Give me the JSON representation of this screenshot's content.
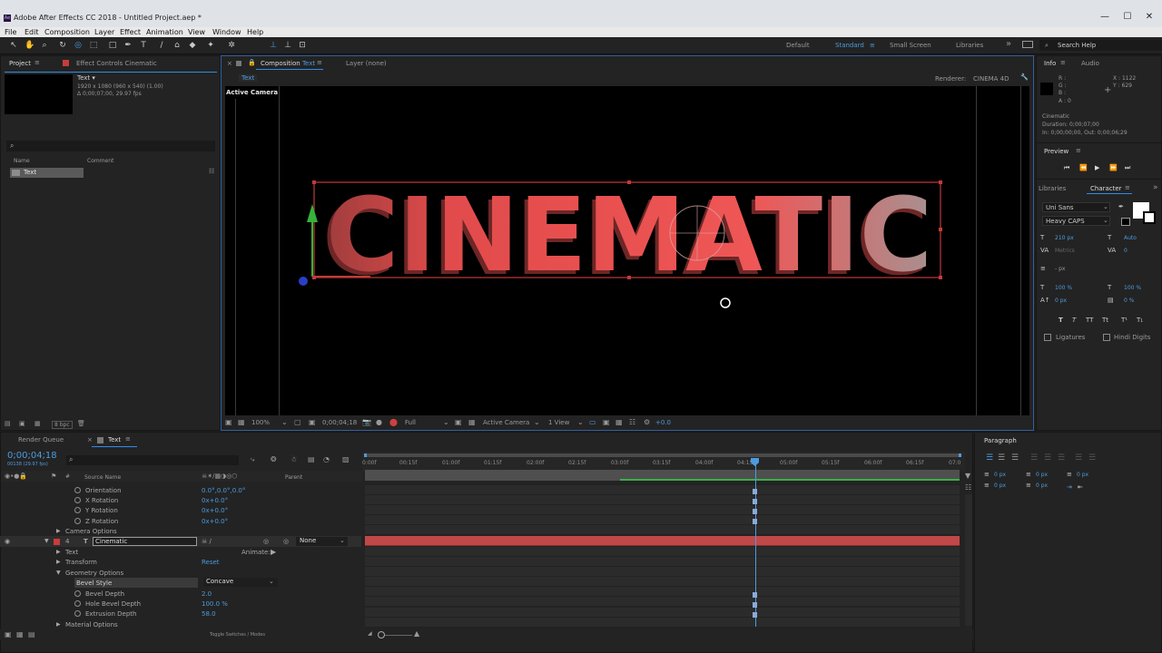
{
  "window": {
    "title": "Adobe After Effects CC 2018 - Untitled Project.aep *",
    "app_icon": "Ae",
    "controls": [
      "—",
      "☐",
      "✕"
    ]
  },
  "menu": [
    "File",
    "Edit",
    "Composition",
    "Layer",
    "Effect",
    "Animation",
    "View",
    "Window",
    "Help"
  ],
  "workspaces": {
    "items": [
      "Default",
      "Standard",
      "Small Screen",
      "Libraries"
    ],
    "active": "Standard",
    "more": "»"
  },
  "search_help": "Search Help",
  "project": {
    "tab": "Project",
    "effect_tab": "Effect Controls Cinematic",
    "item_name": "Text ▾",
    "item_res": "1920 x 1080 (960 x 540) (1.00)",
    "item_dur": "Δ 0;00;07;00, 29.97 fps",
    "col_name": "Name",
    "col_comment": "Comment",
    "row": "Text",
    "bpc": "8 bpc"
  },
  "composition": {
    "tab_prefix": "Composition",
    "tab_name": "Text",
    "layer_tab": "Layer (none)",
    "breadcrumb": "Text",
    "renderer_label": "Renderer:",
    "renderer": "CINEMA 4D",
    "active_camera": "Active Camera",
    "headline": "CINEMATIC"
  },
  "viewer_footer": {
    "zoom": "100%",
    "time": "0;00;04;18",
    "resolution": "Full",
    "camera": "Active Camera",
    "views": "1 View",
    "exposure": "+0.0"
  },
  "info": {
    "tab": "Info",
    "audio_tab": "Audio",
    "rgba": [
      "R :",
      "G :",
      "B :",
      "A : 0"
    ],
    "x": "X : 1122",
    "y": "Y : 629",
    "layer": "Cinematic",
    "duration": "Duration: 0;00;07;00",
    "inout": "In: 0;00;00;00, Out: 0;00;06;29"
  },
  "preview": {
    "tab": "Preview"
  },
  "character": {
    "libraries_tab": "Libraries",
    "tab": "Character",
    "font": "Uni Sans",
    "style": "Heavy CAPS",
    "size": "210 px",
    "leading": "Auto",
    "kerning": "Metrics",
    "tracking": "0",
    "stroke": "- px",
    "vscale": "100 %",
    "hscale": "100 %",
    "baseline": "0 px",
    "tsume": "0 %",
    "ligatures": "Ligatures",
    "hindi": "Hindi Digits",
    "type_buttons": [
      "T",
      "T",
      "TT",
      "Tt",
      "T¹",
      "T₁"
    ]
  },
  "paragraph": {
    "tab": "Paragraph",
    "indent": [
      "0 px",
      "0 px",
      "0 px"
    ],
    "space": [
      "0 px",
      "0 px"
    ]
  },
  "timeline": {
    "render_queue": "Render Queue",
    "tab": "Text",
    "timecode": "0;00;04;18",
    "frames": "00138 (29.97 fps)",
    "col_source": "Source Name",
    "col_parent": "Parent",
    "ruler": [
      "0:00f",
      "00:15f",
      "01:00f",
      "01:15f",
      "02:00f",
      "02:15f",
      "03:00f",
      "03:15f",
      "04:00f",
      "04:15f",
      "05:00f",
      "05:15f",
      "06:00f",
      "06:15f",
      "07:0"
    ],
    "rows": [
      {
        "label": "Orientation",
        "value": "0.0°,0.0°,0.0°"
      },
      {
        "label": "X Rotation",
        "value": "0x+0.0°"
      },
      {
        "label": "Y Rotation",
        "value": "0x+0.0°"
      },
      {
        "label": "Z Rotation",
        "value": "0x+0.0°"
      },
      {
        "label": "Camera Options",
        "value": ""
      },
      {
        "label": "Cinematic",
        "value": "None"
      },
      {
        "label": "Text",
        "value": "Animate:"
      },
      {
        "label": "Transform",
        "value": "Reset"
      },
      {
        "label": "Geometry Options",
        "value": ""
      },
      {
        "label": "Bevel Style",
        "value": "Concave"
      },
      {
        "label": "Bevel Depth",
        "value": "2.0"
      },
      {
        "label": "Hole Bevel Depth",
        "value": "100.0 %"
      },
      {
        "label": "Extrusion Depth",
        "value": "58.0"
      },
      {
        "label": "Material Options",
        "value": ""
      }
    ],
    "layer_number": "4",
    "toggle": "Toggle Switches / Modes",
    "playhead_fraction": 0.657
  },
  "colors": {
    "accent": "#2d8ceb",
    "label_red": "#c83c3c",
    "text_red": "#e55050"
  }
}
